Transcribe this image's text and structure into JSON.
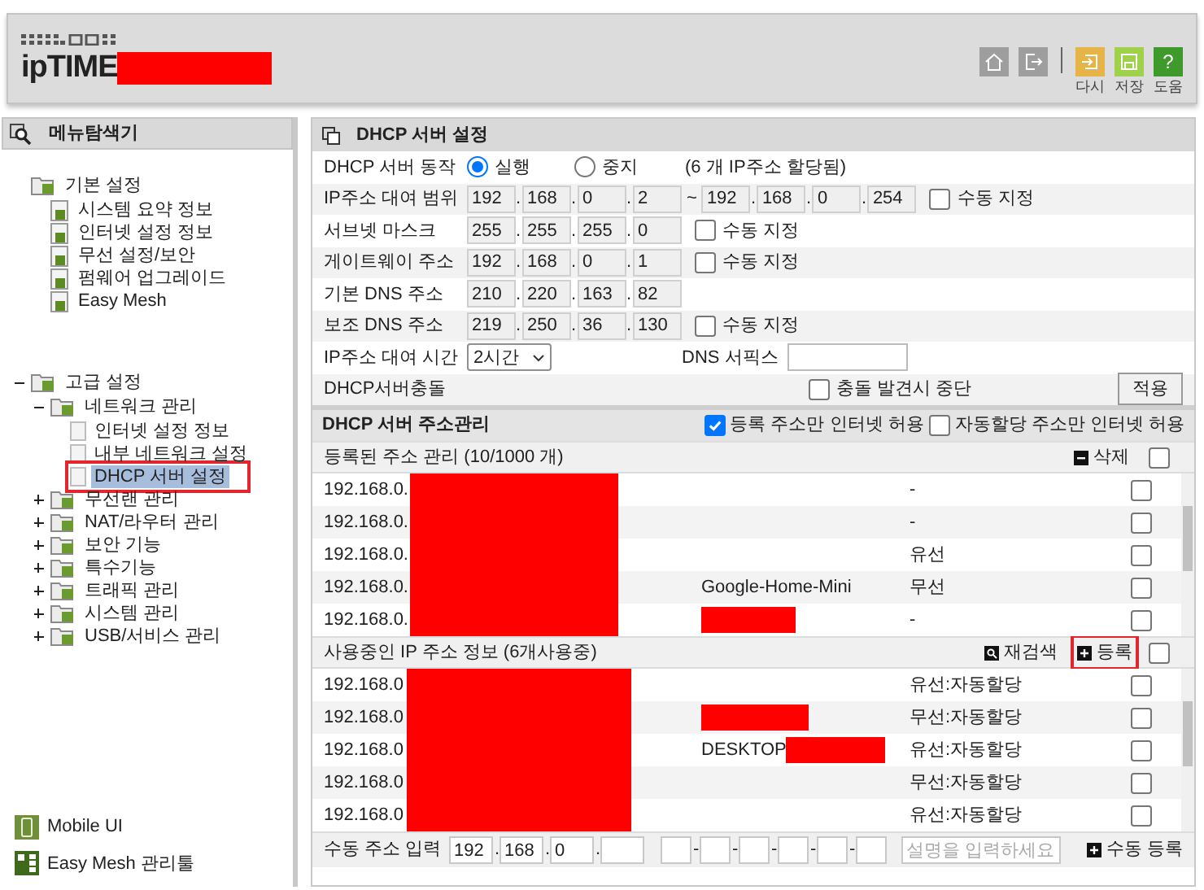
{
  "header": {
    "logo": "ipTIME",
    "toolbar": [
      {
        "kind": "home"
      },
      {
        "kind": "exit"
      },
      {
        "kind": "undo",
        "label": "다시"
      },
      {
        "kind": "save",
        "label": "저장"
      },
      {
        "kind": "help",
        "label": "도움",
        "glyph": "?"
      }
    ]
  },
  "sidebar": {
    "title": "메뉴탐색기",
    "tree": [
      {
        "label": "기본 설정",
        "selected": false,
        "children": [
          {
            "label": "시스템 요약 정보",
            "selected": false
          },
          {
            "label": "인터넷 설정 정보",
            "selected": false
          },
          {
            "label": "무선 설정/보안",
            "selected": false
          },
          {
            "label": "펌웨어 업그레이드",
            "selected": false
          },
          {
            "label": "Easy Mesh",
            "selected": false
          }
        ]
      },
      {
        "label": "고급 설정",
        "selected": false,
        "expanded": true,
        "children": [
          {
            "label": "네트워크 관리",
            "selected": false,
            "expanded": true,
            "children": [
              {
                "label": "인터넷 설정 정보",
                "selected": false
              },
              {
                "label": "내부 네트워크 설정",
                "selected": false
              },
              {
                "label": "DHCP 서버 설정",
                "selected": true,
                "highlighted": true
              }
            ]
          },
          {
            "label": "무선랜 관리",
            "selected": false,
            "expanded": false
          },
          {
            "label": "NAT/라우터 관리",
            "selected": false,
            "expanded": false
          },
          {
            "label": "보안 기능",
            "selected": false,
            "expanded": false
          },
          {
            "label": "특수기능",
            "selected": false,
            "expanded": false
          },
          {
            "label": "트래픽 관리",
            "selected": false,
            "expanded": false
          },
          {
            "label": "시스템 관리",
            "selected": false,
            "expanded": false
          },
          {
            "label": "USB/서비스 관리",
            "selected": false,
            "expanded": false
          }
        ]
      }
    ],
    "links": [
      {
        "kind": "mobile",
        "label": "Mobile UI"
      },
      {
        "kind": "mesh",
        "label": "Easy Mesh 관리툴"
      }
    ]
  },
  "settings": {
    "title": "DHCP 서버 설정",
    "octet_separator": ".",
    "rows": [
      {
        "kind": "radio",
        "label": "DHCP 서버 동작",
        "options": [
          {
            "label": "실행",
            "selected": true
          },
          {
            "label": "중지",
            "selected": false
          }
        ],
        "note": "(6 개 IP주소 할당됨)"
      },
      {
        "kind": "range",
        "label": "IP주소 대여 범위",
        "start": [
          "192",
          "168",
          "0",
          "2"
        ],
        "separator": "~",
        "end": [
          "192",
          "168",
          "0",
          "254"
        ],
        "manual": {
          "label": "수동 지정",
          "checked": false
        }
      },
      {
        "kind": "ip",
        "label": "서브넷 마스크",
        "octets": [
          "255",
          "255",
          "255",
          "0"
        ],
        "manual": {
          "label": "수동 지정",
          "checked": false
        }
      },
      {
        "kind": "ip",
        "label": "게이트웨이 주소",
        "octets": [
          "192",
          "168",
          "0",
          "1"
        ],
        "manual": {
          "label": "수동 지정",
          "checked": false
        }
      },
      {
        "kind": "ip",
        "label": "기본 DNS 주소",
        "octets": [
          "210",
          "220",
          "163",
          "82"
        ]
      },
      {
        "kind": "ip",
        "label": "보조 DNS 주소",
        "octets": [
          "219",
          "250",
          "36",
          "130"
        ],
        "manual": {
          "label": "수동 지정",
          "checked": false
        }
      },
      {
        "kind": "lease",
        "label": "IP주소 대여 시간",
        "value": "2시간",
        "suffix_label": "DNS 서픽스"
      },
      {
        "kind": "conflict",
        "label": "DHCP서버충돌",
        "option": {
          "label": "충돌 발견시 중단",
          "checked": false
        },
        "button": "적용"
      }
    ]
  },
  "address": {
    "title": "DHCP 서버 주소관리",
    "options": [
      {
        "label": "등록 주소만 인터넷 허용",
        "checked": true
      },
      {
        "label": "자동할당 주소만 인터넷 허용",
        "checked": false
      }
    ],
    "registered": {
      "title": "등록된 주소 관리 (10/1000 개)",
      "action": "삭제",
      "checked": false,
      "rows": [
        {
          "ip": "192.168.0.",
          "type": "-",
          "checked": false,
          "name_redacted": false
        },
        {
          "ip": "192.168.0.",
          "type": "-",
          "checked": false,
          "name_redacted": false
        },
        {
          "ip": "192.168.0.",
          "type": "유선",
          "checked": false,
          "name_redacted": false
        },
        {
          "ip": "192.168.0.",
          "name": "Google-Home-Mini",
          "type": "무선",
          "checked": false,
          "name_redacted": false
        },
        {
          "ip": "192.168.0.",
          "type": "-",
          "checked": false,
          "name_redacted": true
        }
      ]
    },
    "in_use": {
      "title": "사용중인 IP 주소 정보 (6개사용중)",
      "actions": [
        {
          "kind": "search",
          "label": "재검색",
          "highlighted": false
        },
        {
          "kind": "add",
          "label": "등록",
          "highlighted": true
        }
      ],
      "checked": false,
      "rows": [
        {
          "ip": "192.168.0",
          "type": "유선:자동할당",
          "checked": false,
          "name_redacted": false
        },
        {
          "ip": "192.168.0",
          "type": "무선:자동할당",
          "checked": false,
          "name_redacted": true
        },
        {
          "ip": "192.168.0",
          "name": "DESKTOP",
          "type": "유선:자동할당",
          "checked": false,
          "name_redacted": true
        },
        {
          "ip": "192.168.0",
          "type": "무선:자동할당",
          "checked": false,
          "name_redacted": false
        },
        {
          "ip": "192.168.0",
          "type": "유선:자동할당",
          "checked": false,
          "name_redacted": false
        }
      ]
    },
    "manual": {
      "label": "수동 주소 입력",
      "octets": [
        "192",
        "168",
        "0"
      ],
      "mac_separator": "-",
      "placeholder": "설명을 입력하세요",
      "button": "수동 등록"
    }
  }
}
